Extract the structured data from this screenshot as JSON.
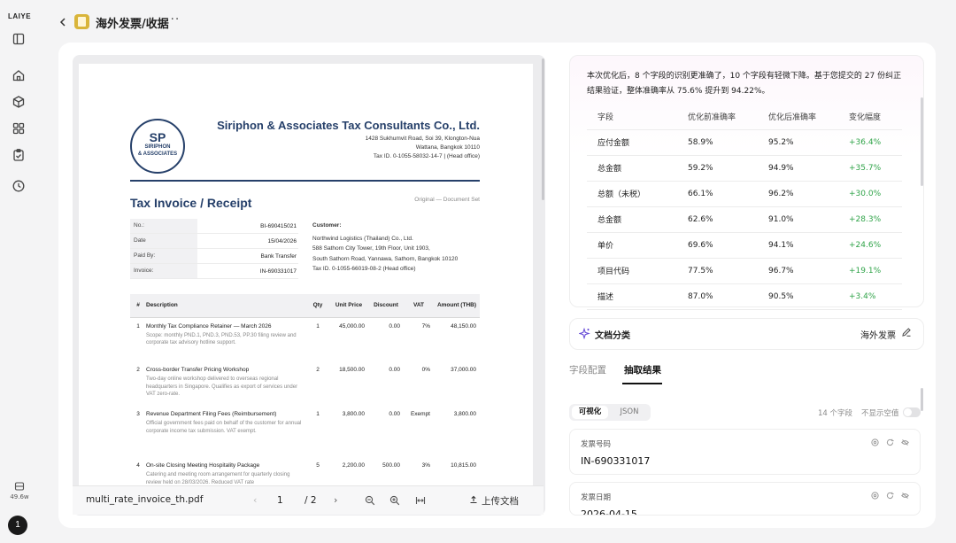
{
  "rail": {
    "logo": "LAIYE",
    "usage": "49.6w",
    "avatar": "1"
  },
  "header": {
    "title": "海外发票/收据",
    "more": "···"
  },
  "preview": {
    "filename": "multi_rate_invoice_th.pdf",
    "page": "1",
    "total": "/ 2",
    "upload_label": "上传文档",
    "doc": {
      "logo_initials": "SP",
      "logo_line1": "SIRIPHON",
      "logo_line2": "& ASSOCIATES",
      "company": "Siriphon & Associates Tax Consultants Co., Ltd.",
      "addr1": "1428 Sukhumvit Road, Soi 39, Klongton-Nua",
      "addr2": "Wattana, Bangkok 10110",
      "addr3": "Tax ID. 0-1055-58032-14-7 | (Head office)",
      "title": "Tax Invoice / Receipt",
      "subtitle": "Original — Document Set",
      "meta": [
        {
          "k": "No.:",
          "v": "BI-690415021"
        },
        {
          "k": "Date",
          "v": "15/04/2026"
        },
        {
          "k": "Paid By:",
          "v": "Bank Transfer"
        },
        {
          "k": "Invoice:",
          "v": "IN-690331017"
        }
      ],
      "customer_label": "Customer:",
      "customer_lines": [
        "Northwind Logistics (Thailand) Co., Ltd.",
        "588 Sathorn City Tower, 19th Floor, Unit 1903,",
        "South Sathorn Road, Yannawa, Sathorn, Bangkok 10120",
        "Tax ID. 0-1055-66019-08-2 (Head office)"
      ],
      "columns": [
        "#",
        "Description",
        "Qty",
        "Unit Price",
        "Discount",
        "VAT",
        "Amount (THB)"
      ],
      "items": [
        {
          "n": "1",
          "desc": "Monthly Tax Compliance Retainer — March 2026",
          "sub": "Scope: monthly PND.1, PND.3, PND.53, PP.30 filing review and corporate tax advisory hotline support.",
          "qty": "1",
          "price": "45,000.00",
          "disc": "0.00",
          "vat": "7%",
          "amt": "48,150.00"
        },
        {
          "n": "2",
          "desc": "Cross-border Transfer Pricing Workshop",
          "sub": "Two-day online workshop delivered to overseas regional headquarters in Singapore. Qualifies as export of services under VAT zero-rate.",
          "qty": "2",
          "price": "18,500.00",
          "disc": "0.00",
          "vat": "0%",
          "amt": "37,000.00"
        },
        {
          "n": "3",
          "desc": "Revenue Department Filing Fees (Reimbursement)",
          "sub": "Official government fees paid on behalf of the customer for annual corporate income tax submission. VAT exempt.",
          "qty": "1",
          "price": "3,800.00",
          "disc": "0.00",
          "vat": "Exempt",
          "amt": "3,800.00"
        },
        {
          "n": "4",
          "desc": "On-site Closing Meeting Hospitality Package",
          "sub": "Catering and meeting room arrangement for quarterly closing review held on 28/03/2026. Reduced VAT rate",
          "qty": "5",
          "price": "2,200.00",
          "disc": "500.00",
          "vat": "3%",
          "amt": "10,815.00"
        }
      ]
    }
  },
  "summary": {
    "text": "本次优化后，8 个字段的识别更准确了，10 个字段有轻微下降。基于您提交的 27 份纠正结果验证，整体准确率从 75.6% 提升到 94.22%。",
    "headers": [
      "字段",
      "优化前准确率",
      "优化后准确率",
      "变化幅度"
    ],
    "rows": [
      {
        "field": "应付金额",
        "before": "58.9%",
        "after": "95.2%",
        "delta": "+36.4%"
      },
      {
        "field": "总金额",
        "before": "59.2%",
        "after": "94.9%",
        "delta": "+35.7%"
      },
      {
        "field": "总额（未税）",
        "before": "66.1%",
        "after": "96.2%",
        "delta": "+30.0%"
      },
      {
        "field": "总金额",
        "before": "62.6%",
        "after": "91.0%",
        "delta": "+28.3%"
      },
      {
        "field": "单价",
        "before": "69.6%",
        "after": "94.1%",
        "delta": "+24.6%"
      },
      {
        "field": "项目代码",
        "before": "77.5%",
        "after": "96.7%",
        "delta": "+19.1%"
      },
      {
        "field": "描述",
        "before": "87.0%",
        "after": "90.5%",
        "delta": "+3.4%"
      }
    ]
  },
  "classification": {
    "label": "文档分类",
    "value": "海外发票"
  },
  "tabs": {
    "config": "字段配置",
    "result": "抽取结果"
  },
  "view": {
    "visual": "可视化",
    "json": "JSON",
    "field_count": "14 个字段",
    "hide_empty": "不显示空值"
  },
  "fields": [
    {
      "label": "发票号码",
      "value": "IN-690331017"
    },
    {
      "label": "发票日期",
      "value": "2026-04-15"
    }
  ],
  "colors": {
    "accent_navy": "#26406a",
    "increase_green": "#2fa348",
    "classify_purple": "#6a4fd8"
  }
}
